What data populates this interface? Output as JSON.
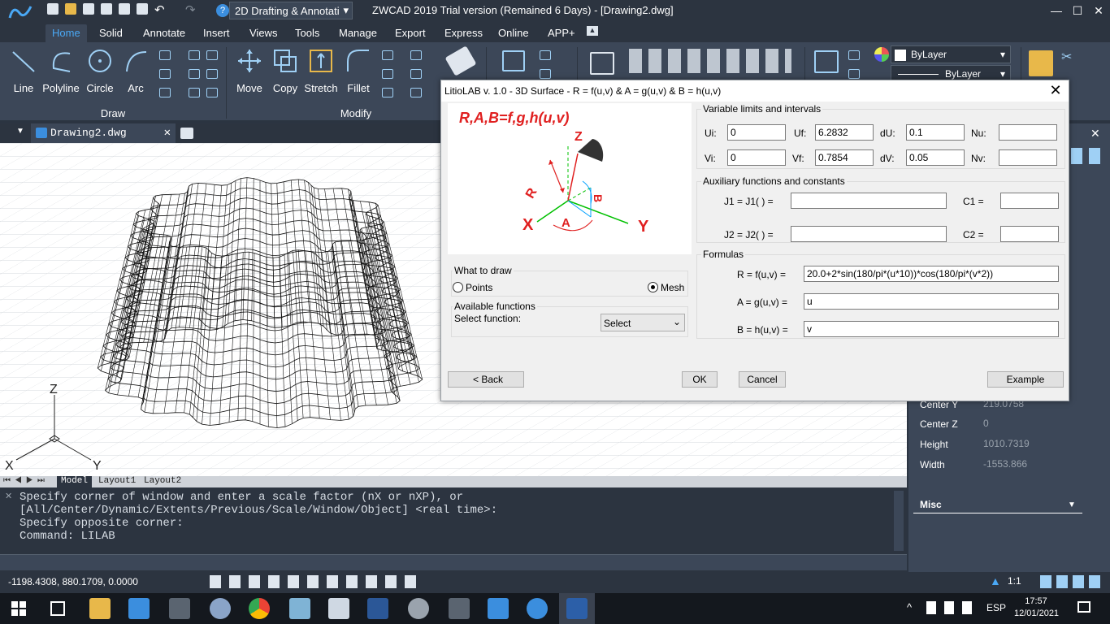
{
  "app": {
    "title": "ZWCAD 2019 Trial version (Remained 6 Days) - [Drawing2.dwg]",
    "workspace": "2D Drafting & Annotati",
    "window_controls": {
      "minimize": "—",
      "maximize": "☐",
      "close": "✕"
    }
  },
  "ribbon": {
    "tabs": [
      "Home",
      "Solid",
      "Annotate",
      "Insert",
      "Views",
      "Tools",
      "Manage",
      "Export",
      "Express",
      "Online",
      "APP+"
    ],
    "active_tab": "Home",
    "draw_panel": {
      "label": "Draw",
      "buttons": [
        "Line",
        "Polyline",
        "Circle",
        "Arc"
      ]
    },
    "modify_panel": {
      "label": "Modify",
      "buttons": [
        "Move",
        "Copy",
        "Stretch",
        "Fillet"
      ]
    },
    "layer": {
      "color": "ByLayer",
      "linetype": "ByLayer"
    }
  },
  "document": {
    "tab": "Drawing2.dwg"
  },
  "layout_tabs": [
    "Model",
    "Layout1",
    "Layout2"
  ],
  "axes": {
    "z": "Z",
    "x": "X",
    "y": "Y"
  },
  "command": {
    "lines": [
      "Specify corner of window and enter a scale factor (nX or nXP), or",
      "[All/Center/Dynamic/Extents/Previous/Scale/Window/Object] <real time>:",
      "Specify opposite corner:",
      "Command: LILAB"
    ]
  },
  "status": {
    "coords": "-1198.4308, 880.1709, 0.0000",
    "scale": "1:1"
  },
  "properties": {
    "rows": [
      {
        "key": "Center Y",
        "value": "219.0758"
      },
      {
        "key": "Center Z",
        "value": "0"
      },
      {
        "key": "Height",
        "value": "1010.7319"
      },
      {
        "key": "Width",
        "value": "-1553.866"
      }
    ],
    "misc_label": "Misc"
  },
  "taskbar": {
    "lang": "ESP",
    "time": "17:57",
    "date": "12/01/2021"
  },
  "dialog": {
    "title": "LitioLAB v. 1.0 - 3D Surface - R = f(u,v) & A = g(u,v) & B = h(u,v)",
    "diagram": {
      "formula": "R,A,B=f,g,h(u,v)",
      "z": "Z",
      "r": "R",
      "b": "B",
      "x": "X",
      "a": "A",
      "y": "Y"
    },
    "limits": {
      "title": "Variable limits and intervals",
      "ui_label": "Ui:",
      "ui": "0",
      "uf_label": "Uf:",
      "uf": "6.2832",
      "du_label": "dU:",
      "du": "0.1",
      "nu_label": "Nu:",
      "nu": "",
      "vi_label": "Vi:",
      "vi": "0",
      "vf_label": "Vf:",
      "vf": "0.7854",
      "dv_label": "dV:",
      "dv": "0.05",
      "nv_label": "Nv:",
      "nv": ""
    },
    "aux": {
      "title": "Auxiliary functions and constants",
      "j1_label": "J1 = J1( ) =",
      "j1": "",
      "c1_label": "C1 =",
      "c1": "",
      "j2_label": "J2 = J2( ) =",
      "j2": "",
      "c2_label": "C2 =",
      "c2": ""
    },
    "formulas": {
      "title": "Formulas",
      "r_label": "R = f(u,v) =",
      "r": "20.0+2*sin(180/pi*(u*10))*cos(180/pi*(v*2))",
      "a_label": "A = g(u,v) =",
      "a": "u",
      "b_label": "B = h(u,v) =",
      "b": "v"
    },
    "draw": {
      "title": "What to draw",
      "points": "Points",
      "mesh": "Mesh",
      "selected": "Mesh"
    },
    "functions": {
      "title": "Available functions",
      "label": "Select function:",
      "select": "Select"
    },
    "buttons": {
      "back": "< Back",
      "ok": "OK",
      "cancel": "Cancel",
      "example": "Example"
    }
  }
}
